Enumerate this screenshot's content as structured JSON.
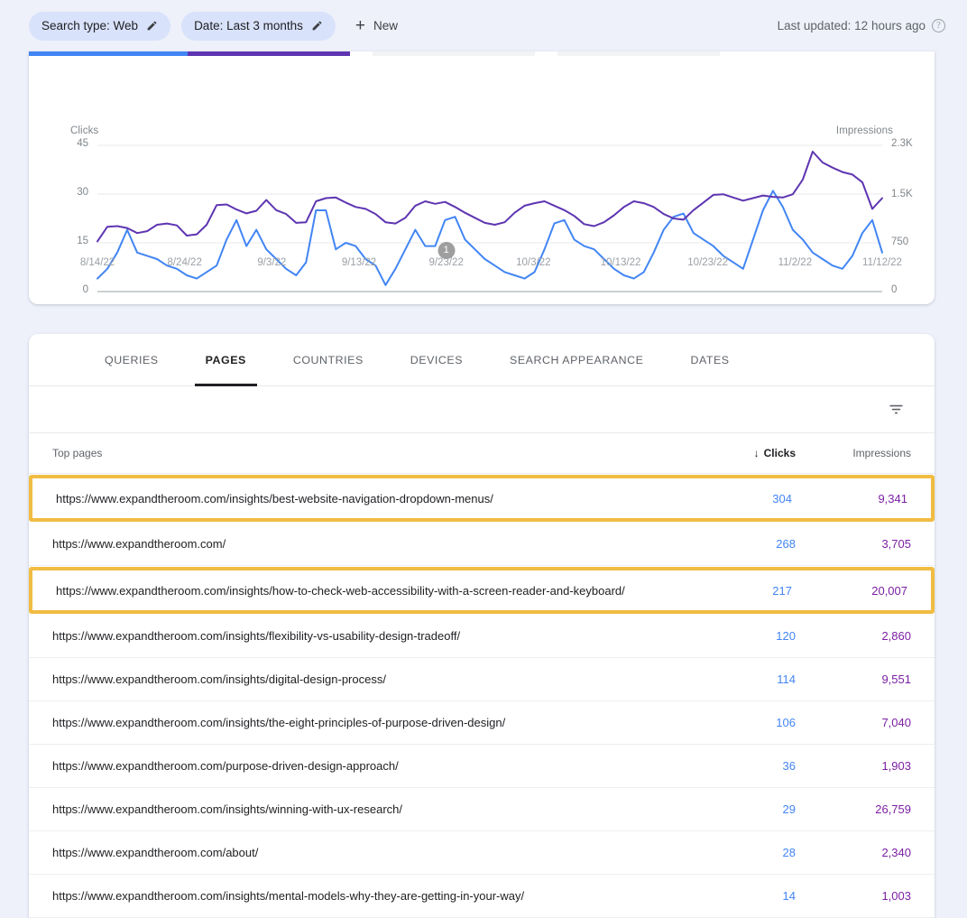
{
  "filter_bar": {
    "chips": [
      {
        "label": "Search type: Web",
        "icon": "pencil-icon"
      },
      {
        "label": "Date: Last 3 months",
        "icon": "pencil-icon"
      }
    ],
    "new_button": {
      "label": "New",
      "icon": "plus-icon"
    },
    "last_updated": "Last updated: 12 hours ago",
    "help_icon": "question-mark-icon"
  },
  "metric_cards": {
    "clicks_color": "#4285f4",
    "impressions_color": "#5e35b1",
    "inactive_color": "#f1f3f4"
  },
  "chart_data": {
    "type": "line",
    "title": "",
    "xlabel": "",
    "ylabel": "Clicks",
    "y2label": "Impressions",
    "grid": true,
    "legend_position": "none",
    "x_tick_labels": [
      "8/14/22",
      "8/24/22",
      "9/3/22",
      "9/13/22",
      "9/23/22",
      "10/3/22",
      "10/13/22",
      "10/23/22",
      "11/2/22",
      "11/12/22"
    ],
    "y_tick_labels": [
      "0",
      "15",
      "30",
      "45"
    ],
    "y_tick_values": [
      0,
      15,
      30,
      45
    ],
    "ylim": [
      0,
      45
    ],
    "y2_tick_labels": [
      "0",
      "750",
      "1.5K",
      "2.3K"
    ],
    "y2_tick_values": [
      0,
      750,
      1500,
      2300
    ],
    "y2lim": [
      0,
      2300
    ],
    "annotations": [
      {
        "label": "1",
        "x_position": "9/23/22"
      }
    ],
    "series": [
      {
        "name": "Clicks",
        "color": "#4285f4",
        "axis": "left",
        "values": [
          4,
          7,
          12,
          19,
          12,
          11,
          10,
          8,
          7,
          5,
          4,
          6,
          8,
          16,
          22,
          14,
          19,
          13,
          10,
          7,
          5,
          9,
          25,
          25,
          13,
          15,
          14,
          10,
          8,
          2,
          7,
          13,
          19,
          14,
          14,
          22,
          23,
          16,
          13,
          10,
          8,
          6,
          5,
          4,
          6,
          13,
          21,
          22,
          16,
          14,
          13,
          10,
          7,
          5,
          4,
          6,
          12,
          19,
          23,
          24,
          18,
          16,
          14,
          11,
          9,
          7,
          16,
          25,
          31,
          26,
          19,
          16,
          12,
          10,
          8,
          7,
          11,
          18,
          22,
          12
        ]
      },
      {
        "name": "Impressions",
        "color": "#5e35b1",
        "axis": "right",
        "values": [
          790,
          1020,
          1030,
          1000,
          920,
          950,
          1050,
          1070,
          1040,
          880,
          900,
          1050,
          1360,
          1370,
          1290,
          1230,
          1270,
          1440,
          1280,
          1220,
          1080,
          1090,
          1420,
          1470,
          1480,
          1400,
          1330,
          1300,
          1220,
          1090,
          1070,
          1160,
          1350,
          1420,
          1380,
          1410,
          1330,
          1240,
          1160,
          1080,
          1050,
          1090,
          1240,
          1350,
          1390,
          1420,
          1350,
          1280,
          1190,
          1060,
          1030,
          1090,
          1200,
          1330,
          1420,
          1390,
          1330,
          1220,
          1150,
          1130,
          1280,
          1400,
          1520,
          1530,
          1480,
          1430,
          1470,
          1510,
          1490,
          1480,
          1530,
          1760,
          2200,
          2030,
          1950,
          1880,
          1840,
          1720,
          1300,
          1470
        ]
      }
    ]
  },
  "table": {
    "tabs": [
      {
        "label": "QUERIES",
        "active": false
      },
      {
        "label": "PAGES",
        "active": true
      },
      {
        "label": "COUNTRIES",
        "active": false
      },
      {
        "label": "DEVICES",
        "active": false
      },
      {
        "label": "SEARCH APPEARANCE",
        "active": false
      },
      {
        "label": "DATES",
        "active": false
      }
    ],
    "filter_icon": "filter-list-icon",
    "columns": {
      "page": "Top pages",
      "clicks": "Clicks",
      "impressions": "Impressions",
      "sort_arrow": "↓"
    },
    "rows": [
      {
        "url": "https://www.expandtheroom.com/insights/best-website-navigation-dropdown-menus/",
        "clicks": "304",
        "impressions": "9,341",
        "highlighted": true
      },
      {
        "url": "https://www.expandtheroom.com/",
        "clicks": "268",
        "impressions": "3,705",
        "highlighted": false
      },
      {
        "url": "https://www.expandtheroom.com/insights/how-to-check-web-accessibility-with-a-screen-reader-and-keyboard/",
        "clicks": "217",
        "impressions": "20,007",
        "highlighted": true
      },
      {
        "url": "https://www.expandtheroom.com/insights/flexibility-vs-usability-design-tradeoff/",
        "clicks": "120",
        "impressions": "2,860",
        "highlighted": false
      },
      {
        "url": "https://www.expandtheroom.com/insights/digital-design-process/",
        "clicks": "114",
        "impressions": "9,551",
        "highlighted": false
      },
      {
        "url": "https://www.expandtheroom.com/insights/the-eight-principles-of-purpose-driven-design/",
        "clicks": "106",
        "impressions": "7,040",
        "highlighted": false
      },
      {
        "url": "https://www.expandtheroom.com/purpose-driven-design-approach/",
        "clicks": "36",
        "impressions": "1,903",
        "highlighted": false
      },
      {
        "url": "https://www.expandtheroom.com/insights/winning-with-ux-research/",
        "clicks": "29",
        "impressions": "26,759",
        "highlighted": false
      },
      {
        "url": "https://www.expandtheroom.com/about/",
        "clicks": "28",
        "impressions": "2,340",
        "highlighted": false
      },
      {
        "url": "https://www.expandtheroom.com/insights/mental-models-why-they-are-getting-in-your-way/",
        "clicks": "14",
        "impressions": "1,003",
        "highlighted": false
      }
    ],
    "highlight_color": "#f0bc42"
  }
}
